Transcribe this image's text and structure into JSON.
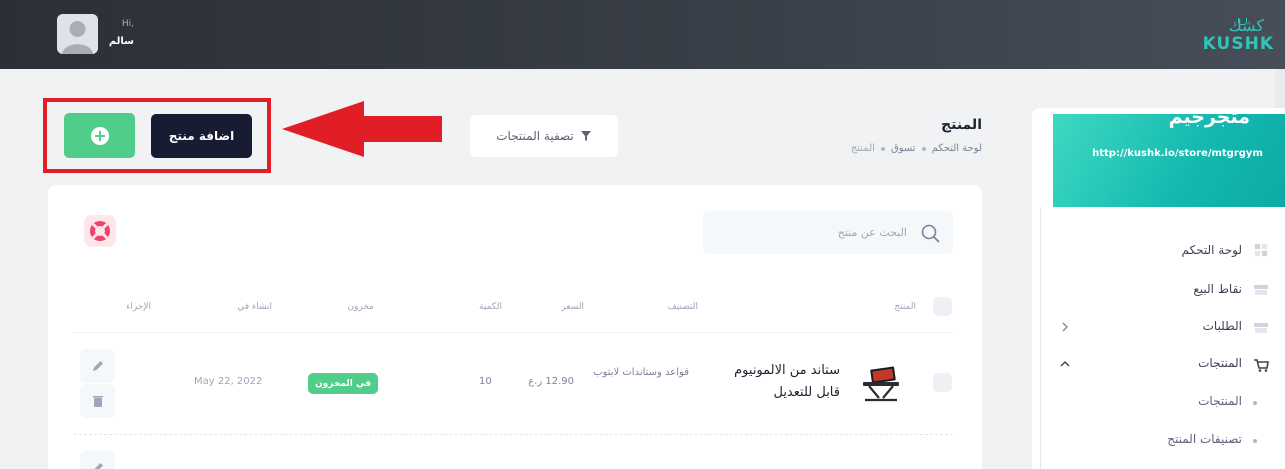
{
  "header": {
    "greeting": "Hi,",
    "user_name": "سالم",
    "logo_ar": "كشك",
    "logo_en": "KUSHK"
  },
  "page": {
    "title": "المنتج",
    "breadcrumb": [
      "لوحة التحكم",
      "تسوق",
      "المنتج"
    ],
    "filter_label": "تصفية المنتجات",
    "add_label": "اضافة منتج"
  },
  "search": {
    "placeholder": "البحث عن منتج"
  },
  "table": {
    "columns": {
      "product": "المنتج",
      "category": "التصنيف",
      "price": "السعر",
      "quantity": "الكمية",
      "stock": "مخزون",
      "created": "انشاء في",
      "actions": "الإجراء"
    },
    "rows": [
      {
        "name": "ستاند من الالمونيوم قابل للتعديل",
        "category": "قواعد وستاندات لابتوب",
        "price": "12.90 ر.ع",
        "quantity": "10",
        "stock_status": "في المخزون",
        "created": "May 22, 2022"
      }
    ]
  },
  "sidebar": {
    "store_name": "متجرجيم",
    "store_url": "http://kushk.io/store/mtgrgym",
    "items": [
      {
        "label": "لوحة التحكم",
        "icon": "dashboard-icon"
      },
      {
        "label": "نقاط البيع",
        "icon": "pos-icon"
      },
      {
        "label": "الطلبات",
        "icon": "orders-icon"
      },
      {
        "label": "المنتجات",
        "icon": "cart-icon"
      }
    ],
    "sub_items": [
      {
        "label": "المنتجات"
      },
      {
        "label": "تصنيفات المنتج"
      }
    ]
  },
  "colors": {
    "header_bg": "#2b2f36",
    "brand_teal": "#2fc6b4",
    "success_green": "#50cd89",
    "dark_button": "#181c32",
    "highlight_red": "#e11d25"
  }
}
